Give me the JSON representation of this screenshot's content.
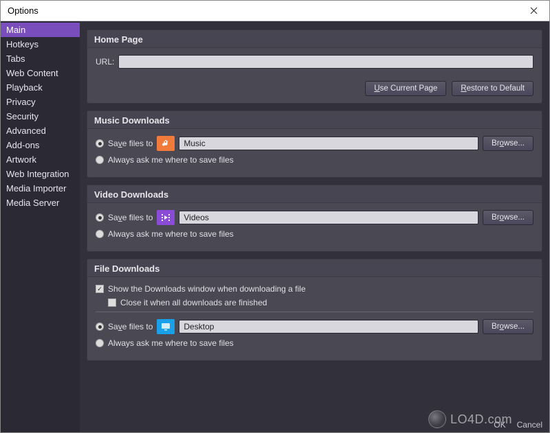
{
  "window": {
    "title": "Options"
  },
  "sidebar": {
    "items": [
      {
        "label": "Main",
        "selected": true
      },
      {
        "label": "Hotkeys"
      },
      {
        "label": "Tabs"
      },
      {
        "label": "Web Content"
      },
      {
        "label": "Playback"
      },
      {
        "label": "Privacy"
      },
      {
        "label": "Security"
      },
      {
        "label": "Advanced"
      },
      {
        "label": "Add-ons"
      },
      {
        "label": "Artwork"
      },
      {
        "label": "Web Integration"
      },
      {
        "label": "Media Importer"
      },
      {
        "label": "Media Server"
      }
    ]
  },
  "home": {
    "title": "Home Page",
    "url_label": "URL:",
    "url_value": "",
    "use_current": "Use Current Page",
    "restore": "Restore to Default"
  },
  "music": {
    "title": "Music Downloads",
    "save_label": "Save files to",
    "path": "Music",
    "browse": "Browse...",
    "always": "Always ask me where to save files"
  },
  "video": {
    "title": "Video Downloads",
    "save_label": "Save files to",
    "path": "Videos",
    "browse": "Browse...",
    "always": "Always ask me where to save files"
  },
  "files": {
    "title": "File Downloads",
    "show": "Show the Downloads window when downloading a file",
    "close": "Close it when all downloads are finished",
    "save_label": "Save files to",
    "path": "Desktop",
    "browse": "Browse...",
    "always": "Always ask me where to save files"
  },
  "footer": {
    "ok": "OK",
    "cancel": "Cancel"
  },
  "watermark": "LO4D.com",
  "colors": {
    "accent": "#7a4dbd",
    "music_folder": "#f07b3a",
    "video_folder": "#8a4cd6",
    "file_folder": "#1aa0e8"
  }
}
